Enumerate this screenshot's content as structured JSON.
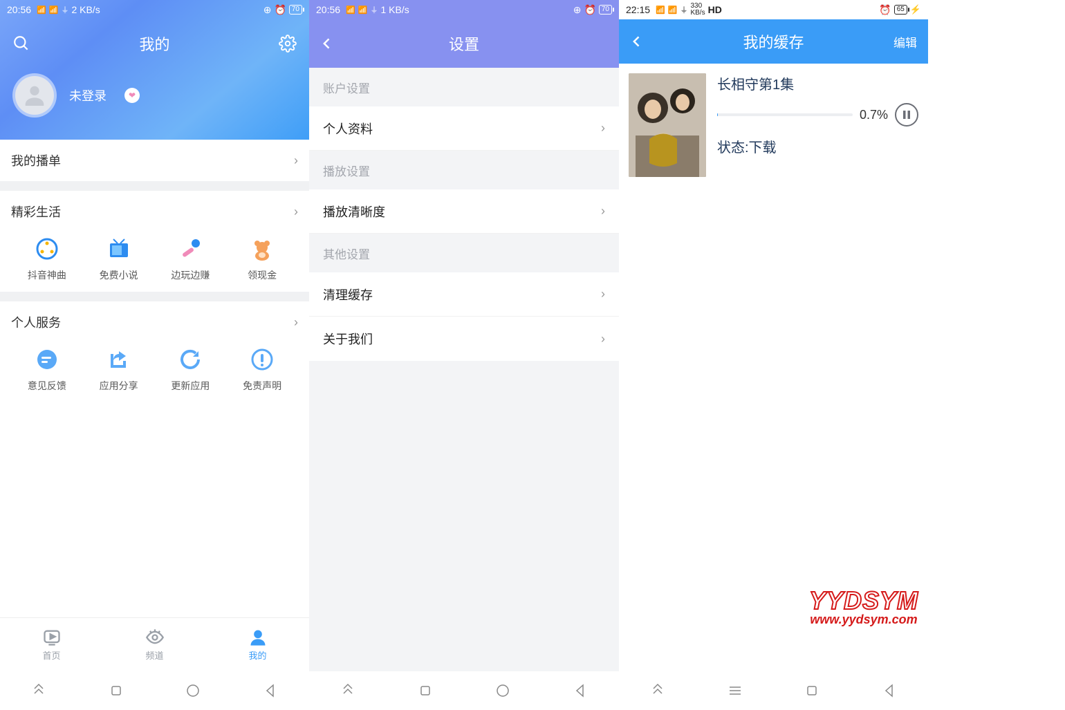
{
  "screen1": {
    "status": {
      "time": "20:56",
      "net_speed": "2 KB/s",
      "battery": "70"
    },
    "header": {
      "title": "我的"
    },
    "login_text": "未登录",
    "sect_playlist": "我的播单",
    "sect_life": "精彩生活",
    "life_items": [
      "抖音神曲",
      "免费小说",
      "边玩边赚",
      "领现金"
    ],
    "sect_service": "个人服务",
    "service_items": [
      "意见反馈",
      "应用分享",
      "更新应用",
      "免责声明"
    ],
    "tabs": [
      "首页",
      "频道",
      "我的"
    ]
  },
  "screen2": {
    "status": {
      "time": "20:56",
      "net_speed": "1 KB/s",
      "battery": "70"
    },
    "header": {
      "title": "设置"
    },
    "sect_account": "账户设置",
    "row_profile": "个人资料",
    "sect_playback": "播放设置",
    "row_quality": "播放清晰度",
    "sect_other": "其他设置",
    "row_clear": "清理缓存",
    "row_about": "关于我们"
  },
  "screen3": {
    "status": {
      "time": "22:15",
      "net_speed": "330",
      "net_unit": "KB/s",
      "hd": "HD",
      "battery": "65"
    },
    "header": {
      "title": "我的缓存",
      "edit": "编辑"
    },
    "item": {
      "title": "长相守第1集",
      "percent": "0.7%",
      "progress_width": "0.7%",
      "status": "状态:下载"
    },
    "watermark": {
      "line1": "YYDSYM",
      "line2": "www.yydsym.com"
    }
  }
}
